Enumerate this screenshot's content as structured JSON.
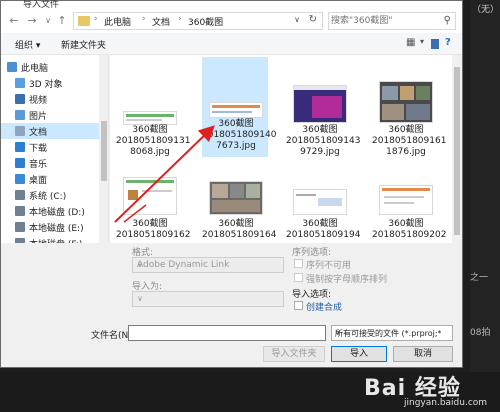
{
  "window": {
    "title": "导入文件"
  },
  "bg_app": {
    "right_top": "（无）",
    "right_mid": "之一",
    "right_low": "08拍"
  },
  "nav": {
    "back_icon": "arrow-left-icon",
    "forward_icon": "arrow-right-icon",
    "up_icon": "arrow-up-icon",
    "breadcrumbs": [
      "此电脑",
      "文档",
      "360截图"
    ],
    "search_placeholder": "搜索\"360截图\""
  },
  "toolbar": {
    "organize": "组织 ▾",
    "new_folder": "新建文件夹"
  },
  "sidebar": {
    "items": [
      {
        "label": "此电脑",
        "icon": "computer-icon",
        "color": "#4a8fd6"
      },
      {
        "label": "3D 对象",
        "icon": "cube-icon",
        "color": "#5aa0e0"
      },
      {
        "label": "视频",
        "icon": "video-icon",
        "color": "#3a6fb0"
      },
      {
        "label": "图片",
        "icon": "picture-icon",
        "color": "#5a9ad8"
      },
      {
        "label": "文档",
        "icon": "document-icon",
        "color": "#8fa4c0"
      },
      {
        "label": "下载",
        "icon": "download-icon",
        "color": "#2f7fd0"
      },
      {
        "label": "音乐",
        "icon": "music-icon",
        "color": "#2f7fd0"
      },
      {
        "label": "桌面",
        "icon": "desktop-icon",
        "color": "#3a8ad8"
      },
      {
        "label": "系统 (C:)",
        "icon": "drive-icon",
        "color": "#6f8090"
      },
      {
        "label": "本地磁盘 (D:)",
        "icon": "drive-icon",
        "color": "#6f8090"
      },
      {
        "label": "本地磁盘 (E:)",
        "icon": "drive-icon",
        "color": "#6f8090"
      },
      {
        "label": "本地磁盘 (F:)",
        "icon": "drive-icon",
        "color": "#6f8090"
      }
    ]
  },
  "files": [
    {
      "line1": "360截图",
      "line2": "2018051809131",
      "line3": "8068.jpg"
    },
    {
      "line1": "360截图",
      "line2": "2018051809140",
      "line3": "7673.jpg"
    },
    {
      "line1": "360截图",
      "line2": "2018051809143",
      "line3": "9729.jpg"
    },
    {
      "line1": "360截图",
      "line2": "2018051809161",
      "line3": "1876.jpg"
    },
    {
      "line1": "360截图",
      "line2": "2018051809162",
      "line3": ""
    },
    {
      "line1": "360截图",
      "line2": "2018051809164",
      "line3": ""
    },
    {
      "line1": "360截图",
      "line2": "2018051809194",
      "line3": ""
    },
    {
      "line1": "360截图",
      "line2": "2018051809202",
      "line3": ""
    }
  ],
  "options": {
    "format_label": "格式:",
    "format_value": "Adobe Dynamic Link",
    "import_as_label": "导入为:",
    "import_as_value": "",
    "sequence_label": "序列选项:",
    "seq_unavailable": "序列不可用",
    "force_alpha": "强制按字母顺序排列",
    "import_options_label": "导入选项:",
    "create_comp": "创建合成"
  },
  "bottom": {
    "filename_label": "文件名(N):",
    "filename_value": "",
    "filetype_value": "所有可接受的文件 (*.prproj;*.c",
    "import_folder": "导入文件夹",
    "import": "导入",
    "cancel": "取消"
  },
  "watermark": {
    "text": "Bai 经验",
    "sub": "jingyan.baidu.com"
  }
}
